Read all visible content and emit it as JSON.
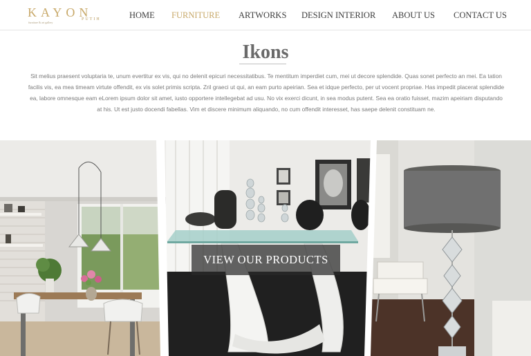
{
  "brand": {
    "name": "KAYON",
    "tagline_right": "PUTIH",
    "tagline_left": "furniture & art gallery"
  },
  "nav": {
    "items": [
      {
        "label": "HOME",
        "active": false
      },
      {
        "label": "FURNITURE",
        "active": true
      },
      {
        "label": "ARTWORKS",
        "active": false
      },
      {
        "label": "DESIGN INTERIOR",
        "active": false
      },
      {
        "label": "ABOUT US",
        "active": false
      },
      {
        "label": "CONTACT US",
        "active": false
      }
    ],
    "active_color": "#c8a96a"
  },
  "main": {
    "title": "Ikons",
    "description": "Sit melius praesent voluptaria te, unum evertitur ex vis, qui no delenit epicuri necessitatibus. Te mentitum imperdiet cum, mei ut decore splendide. Quas sonet perfecto an mei. Ea tation facilis vis, ea mea timeam virtute offendit, ex vis solet primis scripta. Zril graeci ut qui, an eam purto apeirian. Sea et idque perfecto, per ut vocent propriae. Has impedit placerat splendide ea, labore omnesque eam eLorem ipsum dolor sit amet, iusto opportere intellegebat ad usu. No vix exerci dicunt, in sea modus putent. Sea ea oratio fuisset, mazim apeiriam disputando at his. Ut est justo docendi fabellas. Vim et discere minimum aliquando, no cum offendit interesset, has saepe delenit constituam ne.",
    "cta_label": "VIEW OUR PRODUCTS"
  },
  "gallery": {
    "panels": [
      "dining-room-photo",
      "glass-table-photo",
      "lamp-photo"
    ]
  }
}
